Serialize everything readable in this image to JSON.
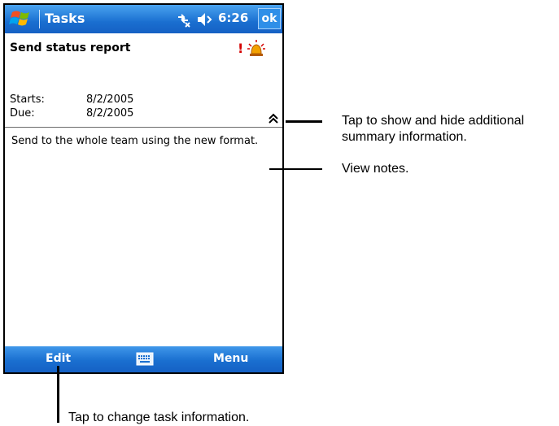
{
  "titlebar": {
    "app_title": "Tasks",
    "clock": "6:26",
    "ok_label": "ok"
  },
  "task": {
    "subject": "Send status report",
    "priority_mark": "!",
    "starts_label": "Starts:",
    "starts_value": "8/2/2005",
    "due_label": "Due:",
    "due_value": "8/2/2005",
    "notes": "Send to the whole team using the new format."
  },
  "menubar": {
    "edit_label": "Edit",
    "menu_label": "Menu"
  },
  "callouts": {
    "summary_toggle": "Tap to show and hide additional summary information.",
    "view_notes": "View notes.",
    "edit_info": "Tap to change task information."
  },
  "colors": {
    "bar_blue": "#1a6fd0",
    "priority_red": "#d40000"
  }
}
